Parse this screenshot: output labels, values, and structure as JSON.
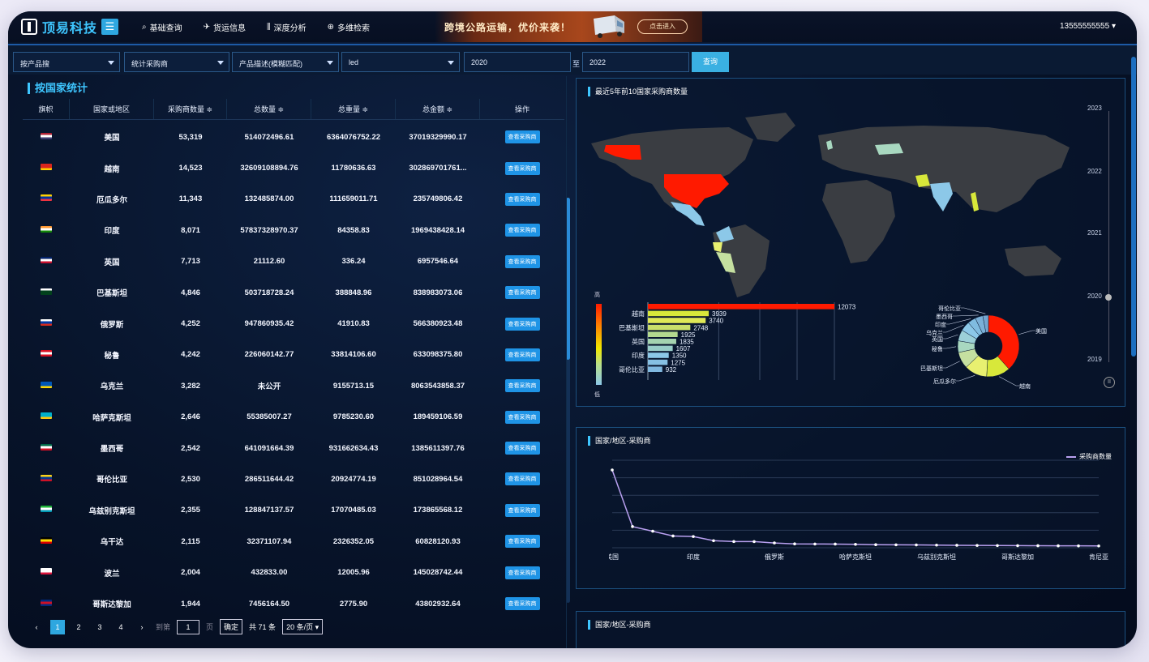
{
  "header": {
    "brand": "顶易科技",
    "nav": [
      {
        "label": "基础查询",
        "icon": "search-icon"
      },
      {
        "label": "货运信息",
        "icon": "plane-icon"
      },
      {
        "label": "深度分析",
        "icon": "chart-icon"
      },
      {
        "label": "多维检索",
        "icon": "target-icon"
      }
    ],
    "promo": "跨境公路运输，优价来袭！",
    "promo_button": "点击进入",
    "user": "13555555555"
  },
  "filters": {
    "f1": "按产品搜",
    "f2": "统计采购商",
    "f3": "产品描述(模糊匹配)",
    "keyword": "led",
    "from": "2020",
    "to_label": "至",
    "to": "2022",
    "query_button": "查询"
  },
  "left": {
    "title": "按国家统计",
    "columns": [
      "旗帜",
      "国家或地区",
      "采购商数量 ≑",
      "总数量 ≑",
      "总重量 ≑",
      "总金额 ≑",
      "操作"
    ],
    "action_label": "查看采购商",
    "rows": [
      {
        "flag": [
          "#b22234",
          "#ffffff",
          "#3c3b6e"
        ],
        "country": "美国",
        "buyers": "53,319",
        "qty": "514072496.61",
        "weight": "6364076752.22",
        "amount": "37019329990.17"
      },
      {
        "flag": [
          "#da251d",
          "#da251d",
          "#ffcd00"
        ],
        "country": "越南",
        "buyers": "14,523",
        "qty": "32609108894.76",
        "weight": "11780636.63",
        "amount": "302869701761..."
      },
      {
        "flag": [
          "#ffd100",
          "#0033a0",
          "#ef3340"
        ],
        "country": "厄瓜多尔",
        "buyers": "11,343",
        "qty": "132485874.00",
        "weight": "111659011.71",
        "amount": "235749806.42"
      },
      {
        "flag": [
          "#ff9933",
          "#ffffff",
          "#138808"
        ],
        "country": "印度",
        "buyers": "8,071",
        "qty": "57837328970.37",
        "weight": "84358.83",
        "amount": "1969438428.14"
      },
      {
        "flag": [
          "#012169",
          "#ffffff",
          "#c8102e"
        ],
        "country": "英国",
        "buyers": "7,713",
        "qty": "21112.60",
        "weight": "336.24",
        "amount": "6957546.64"
      },
      {
        "flag": [
          "#ffffff",
          "#01411c",
          "#01411c"
        ],
        "country": "巴基斯坦",
        "buyers": "4,846",
        "qty": "503718728.24",
        "weight": "388848.96",
        "amount": "838983073.06"
      },
      {
        "flag": [
          "#ffffff",
          "#0039a6",
          "#d52b1e"
        ],
        "country": "俄罗斯",
        "buyers": "4,252",
        "qty": "947860935.42",
        "weight": "41910.83",
        "amount": "566380923.48"
      },
      {
        "flag": [
          "#d91023",
          "#ffffff",
          "#d91023"
        ],
        "country": "秘鲁",
        "buyers": "4,242",
        "qty": "226060142.77",
        "weight": "33814106.60",
        "amount": "633098375.80"
      },
      {
        "flag": [
          "#0057b7",
          "#0057b7",
          "#ffd700"
        ],
        "country": "乌克兰",
        "buyers": "3,282",
        "qty": "未公开",
        "weight": "9155713.15",
        "amount": "8063543858.37"
      },
      {
        "flag": [
          "#00afca",
          "#00afca",
          "#fec50c"
        ],
        "country": "哈萨克斯坦",
        "buyers": "2,646",
        "qty": "55385007.27",
        "weight": "9785230.60",
        "amount": "189459106.59"
      },
      {
        "flag": [
          "#006847",
          "#ffffff",
          "#ce1126"
        ],
        "country": "墨西哥",
        "buyers": "2,542",
        "qty": "641091664.39",
        "weight": "931662634.43",
        "amount": "1385611397.76"
      },
      {
        "flag": [
          "#fcd116",
          "#003893",
          "#ce1126"
        ],
        "country": "哥伦比亚",
        "buyers": "2,530",
        "qty": "286511644.42",
        "weight": "20924774.19",
        "amount": "851028964.54"
      },
      {
        "flag": [
          "#1eb53a",
          "#ffffff",
          "#0099b5"
        ],
        "country": "乌兹别克斯坦",
        "buyers": "2,355",
        "qty": "128847137.57",
        "weight": "17070485.03",
        "amount": "173865568.12"
      },
      {
        "flag": [
          "#000000",
          "#fcdc04",
          "#d90000"
        ],
        "country": "乌干达",
        "buyers": "2,115",
        "qty": "32371107.94",
        "weight": "2326352.05",
        "amount": "60828120.93"
      },
      {
        "flag": [
          "#ffffff",
          "#ffffff",
          "#dc143c"
        ],
        "country": "波兰",
        "buyers": "2,004",
        "qty": "432833.00",
        "weight": "12005.96",
        "amount": "145028742.44"
      },
      {
        "flag": [
          "#002b7f",
          "#ce1126",
          "#002b7f"
        ],
        "country": "哥斯达黎加",
        "buyers": "1,944",
        "qty": "7456164.50",
        "weight": "2775.90",
        "amount": "43802932.64"
      }
    ],
    "pager": {
      "pages": [
        "1",
        "2",
        "3",
        "4"
      ],
      "goto_label": "到第",
      "goto_value": "1",
      "page_unit": "页",
      "ok": "确定",
      "total": "共 71 条",
      "page_size": "20 条/页"
    }
  },
  "panel1": {
    "title": "最近5年前10国家采购商数量",
    "legend_high": "高",
    "legend_low": "低",
    "years": [
      "2023",
      "2022",
      "2021",
      "2020",
      "2019"
    ],
    "current_year": "2020"
  },
  "panel2": {
    "title": "国家/地区-采购商",
    "legend": "采购商数量"
  },
  "panel3": {
    "title": "国家/地区-采购商"
  },
  "chart_data": [
    {
      "type": "bar",
      "orientation": "horizontal",
      "categories": [
        "",
        "越南",
        "",
        "巴基斯坦",
        "",
        "英国",
        "",
        "印度",
        "",
        "哥伦比亚"
      ],
      "values": [
        12073,
        3939,
        3740,
        2748,
        1925,
        1835,
        1607,
        1350,
        1275,
        932
      ]
    },
    {
      "type": "pie",
      "labels": [
        "美国",
        "越南",
        "厄瓜多尔",
        "巴基斯坦",
        "秘鲁",
        "英国",
        "乌克兰",
        "印度",
        "墨西哥",
        "哥伦比亚"
      ],
      "values": [
        12073,
        3939,
        3740,
        2748,
        1925,
        1835,
        1607,
        1350,
        1275,
        932
      ],
      "colors": [
        "#ff1a00",
        "#d8e83a",
        "#e8f070",
        "#c5e0a0",
        "#a8d8c0",
        "#9cd0d8",
        "#8cc8e8",
        "#80bce0",
        "#7ab0d8",
        "#75a6d0"
      ]
    },
    {
      "type": "line",
      "categories": [
        "美国",
        "",
        "印度",
        "",
        "俄罗斯",
        "",
        "哈萨克斯坦",
        "",
        "乌兹别克斯坦",
        "",
        "哥斯达黎加",
        "",
        "肯尼亚"
      ],
      "series": [
        {
          "name": "采购商数量",
          "values": [
            53319,
            14523,
            11343,
            8071,
            7713,
            4846,
            4252,
            4242,
            3282,
            2646,
            2542,
            2530,
            2355,
            2115,
            2004,
            1944,
            1800,
            1700,
            1600,
            1500,
            1450,
            1400,
            1350,
            1300,
            1250
          ]
        }
      ]
    }
  ]
}
